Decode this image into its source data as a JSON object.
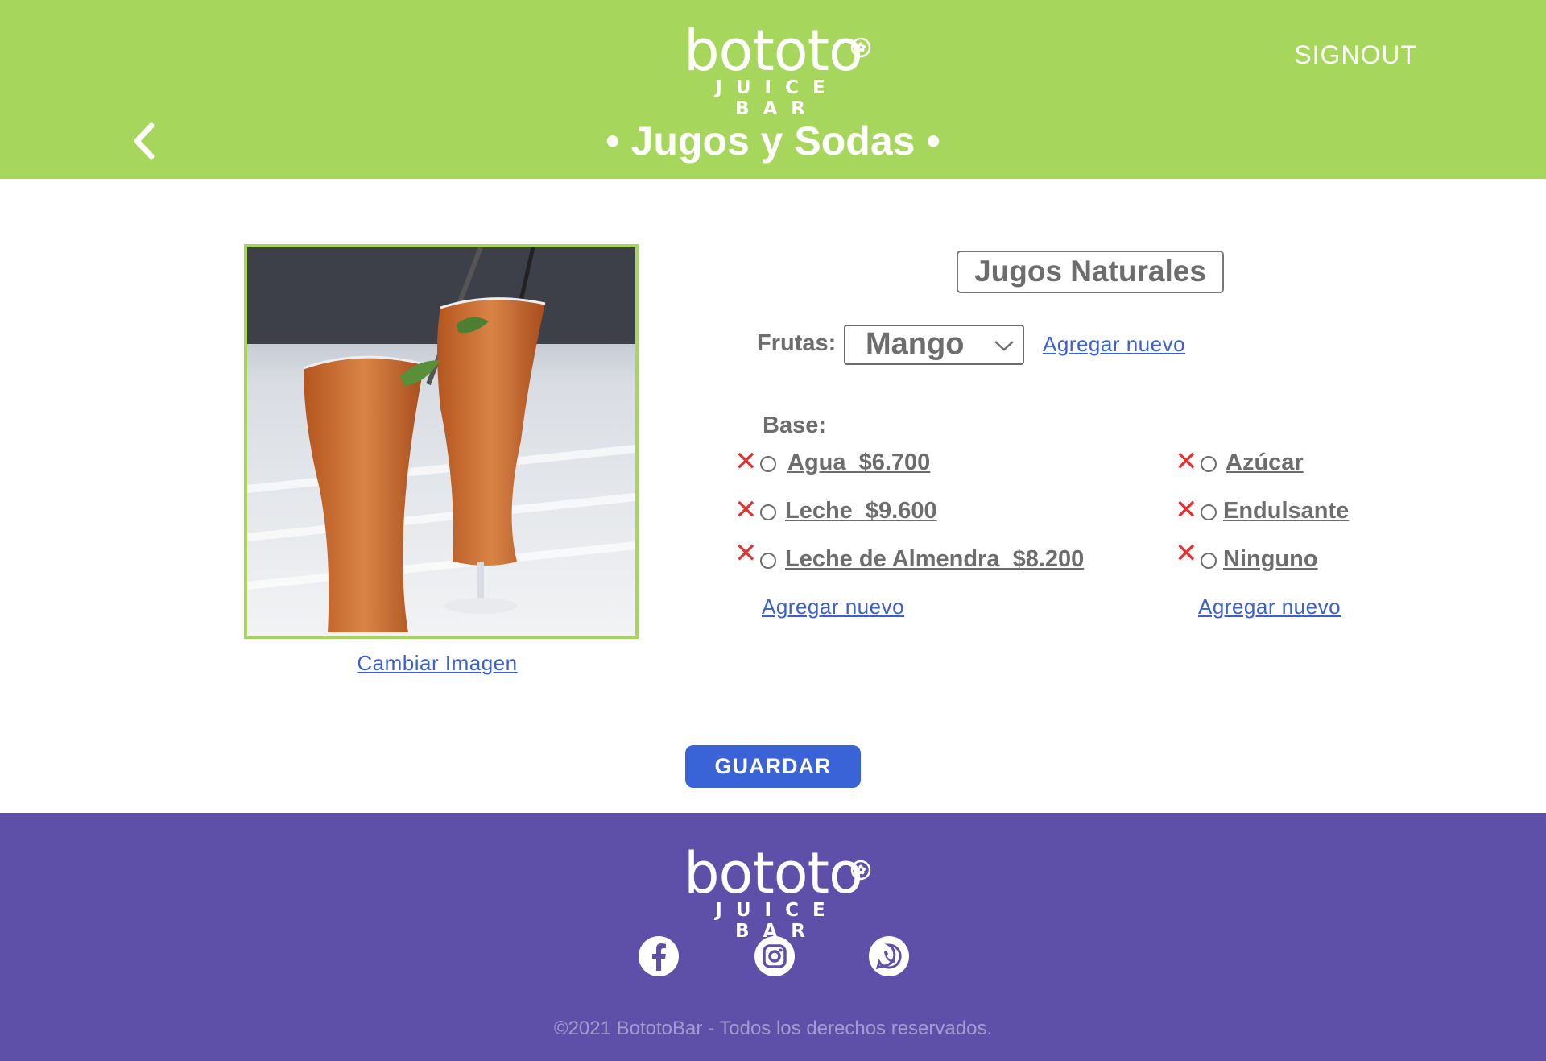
{
  "brand": {
    "name": "bototo",
    "tagline": "JUICE BAR"
  },
  "header": {
    "signout_label": "SIGNOUT",
    "page_title": "• Jugos y Sodas •"
  },
  "product": {
    "change_image_label": "Cambiar Imagen",
    "category": "Jugos Naturales",
    "fruits_label": "Frutas:",
    "fruit_selected": "Mango",
    "fruits_add_label": "Agregar nuevo",
    "base_label": "Base:",
    "base_options": [
      {
        "label": "Agua  $6.700"
      },
      {
        "label": "Leche  $9.600"
      },
      {
        "label": "Leche de Almendra  $8.200"
      }
    ],
    "sweetener_options": [
      {
        "label": "Azúcar"
      },
      {
        "label": "Endulsante"
      },
      {
        "label": "Ninguno"
      }
    ],
    "add_base_label": "Agregar nuevo",
    "add_sweetener_label": "Agregar nuevo",
    "remove_symbol": "✕"
  },
  "actions": {
    "save_label": "GUARDAR"
  },
  "footer": {
    "copyright": "©2021 BototoBar - Todos los derechos reservados."
  },
  "colors": {
    "header_bg": "#a7d65d",
    "footer_bg": "#5e50a8",
    "primary": "#3a63d8",
    "remove": "#e23333"
  },
  "icons": [
    "back-chevron-icon",
    "dropdown-chevron-icon",
    "facebook-icon",
    "instagram-icon",
    "whatsapp-icon",
    "remove-x-icon",
    "radio-icon"
  ]
}
